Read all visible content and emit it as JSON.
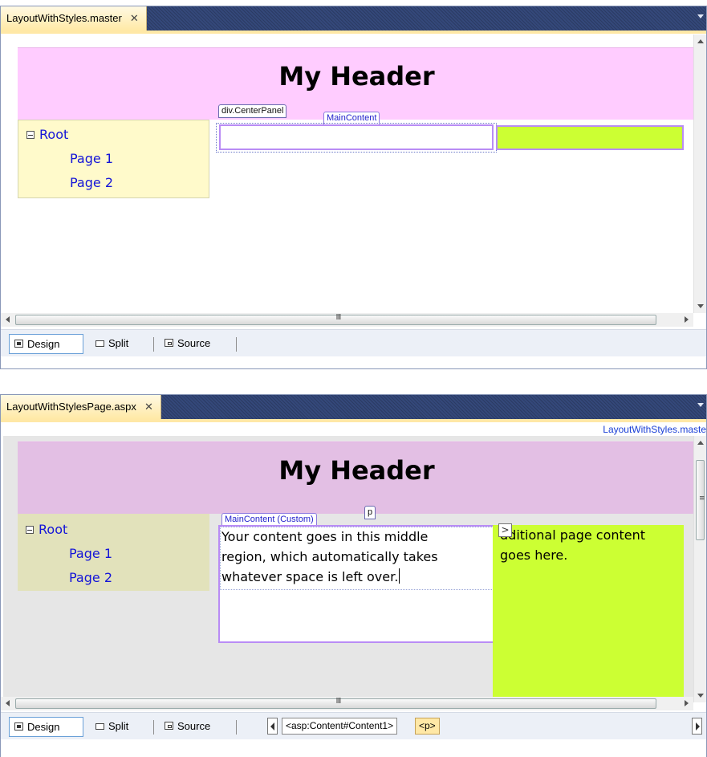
{
  "colors": {
    "header_bg_design": "#ffccff",
    "header_bg_page": "#e3bfe4",
    "nav_bg_design": "#fffacb",
    "nav_bg_page": "#e2e2bb",
    "right_panel": "#ccff33",
    "link_blue": "#1414d8",
    "tab_gold": "#ffe9a6"
  },
  "master_editor": {
    "tab_label": "LayoutWithStyles.master",
    "header_title": "My Header",
    "nav": {
      "root": "Root",
      "page1": "Page 1",
      "page2": "Page 2"
    },
    "tags": {
      "center_panel": "div.CenterPanel",
      "main_content": "MainContent"
    },
    "view_tabs": {
      "design": "Design",
      "split": "Split",
      "source": "Source"
    },
    "hscroll_grip": "III"
  },
  "page_editor": {
    "tab_label": "LayoutWithStylesPage.aspx",
    "master_link": "LayoutWithStyles.maste",
    "header_title": "My Header",
    "nav": {
      "root": "Root",
      "page1": "Page 1",
      "page2": "Page 2"
    },
    "tags": {
      "main_content_custom": "MainContent (Custom)",
      "p": "p"
    },
    "content_lines": [
      "Your content goes in this middle",
      "region, which automatically takes",
      "whatever space is left over."
    ],
    "right_lines": [
      "dditional page content",
      "goes here."
    ],
    "view_tabs": {
      "design": "Design",
      "split": "Split",
      "source": "Source"
    },
    "breadcrumbs": [
      "<asp:Content#Content1>",
      "<p>"
    ],
    "hscroll_grip": "III",
    "vscroll_grip": "≡",
    "smarttag_glyph": ">"
  }
}
